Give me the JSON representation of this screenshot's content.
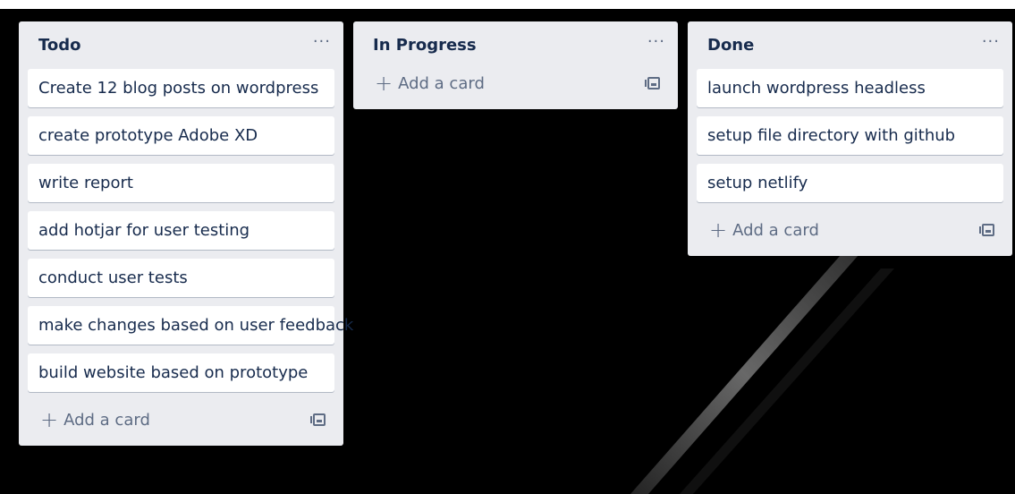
{
  "lists": [
    {
      "title": "Todo",
      "menu": "···",
      "cards": [
        "Create 12 blog posts on wordpress",
        "create prototype Adobe XD",
        "write report",
        "add hotjar for user testing",
        "conduct user tests",
        "make changes based on user feedback",
        "build website based on prototype"
      ],
      "add_label": "Add a card"
    },
    {
      "title": "In Progress",
      "menu": "···",
      "cards": [],
      "add_label": "Add a card"
    },
    {
      "title": "Done",
      "menu": "···",
      "cards": [
        "launch wordpress headless",
        "setup file directory with github",
        "setup netlify"
      ],
      "add_label": "Add a card"
    }
  ],
  "icons": {
    "plus": "+",
    "template": "card-template-icon"
  },
  "colors": {
    "list_bg": "#ebecf0",
    "card_bg": "#ffffff",
    "text": "#172b4d",
    "muted": "#5e6c84",
    "board_bg": "#000000"
  }
}
